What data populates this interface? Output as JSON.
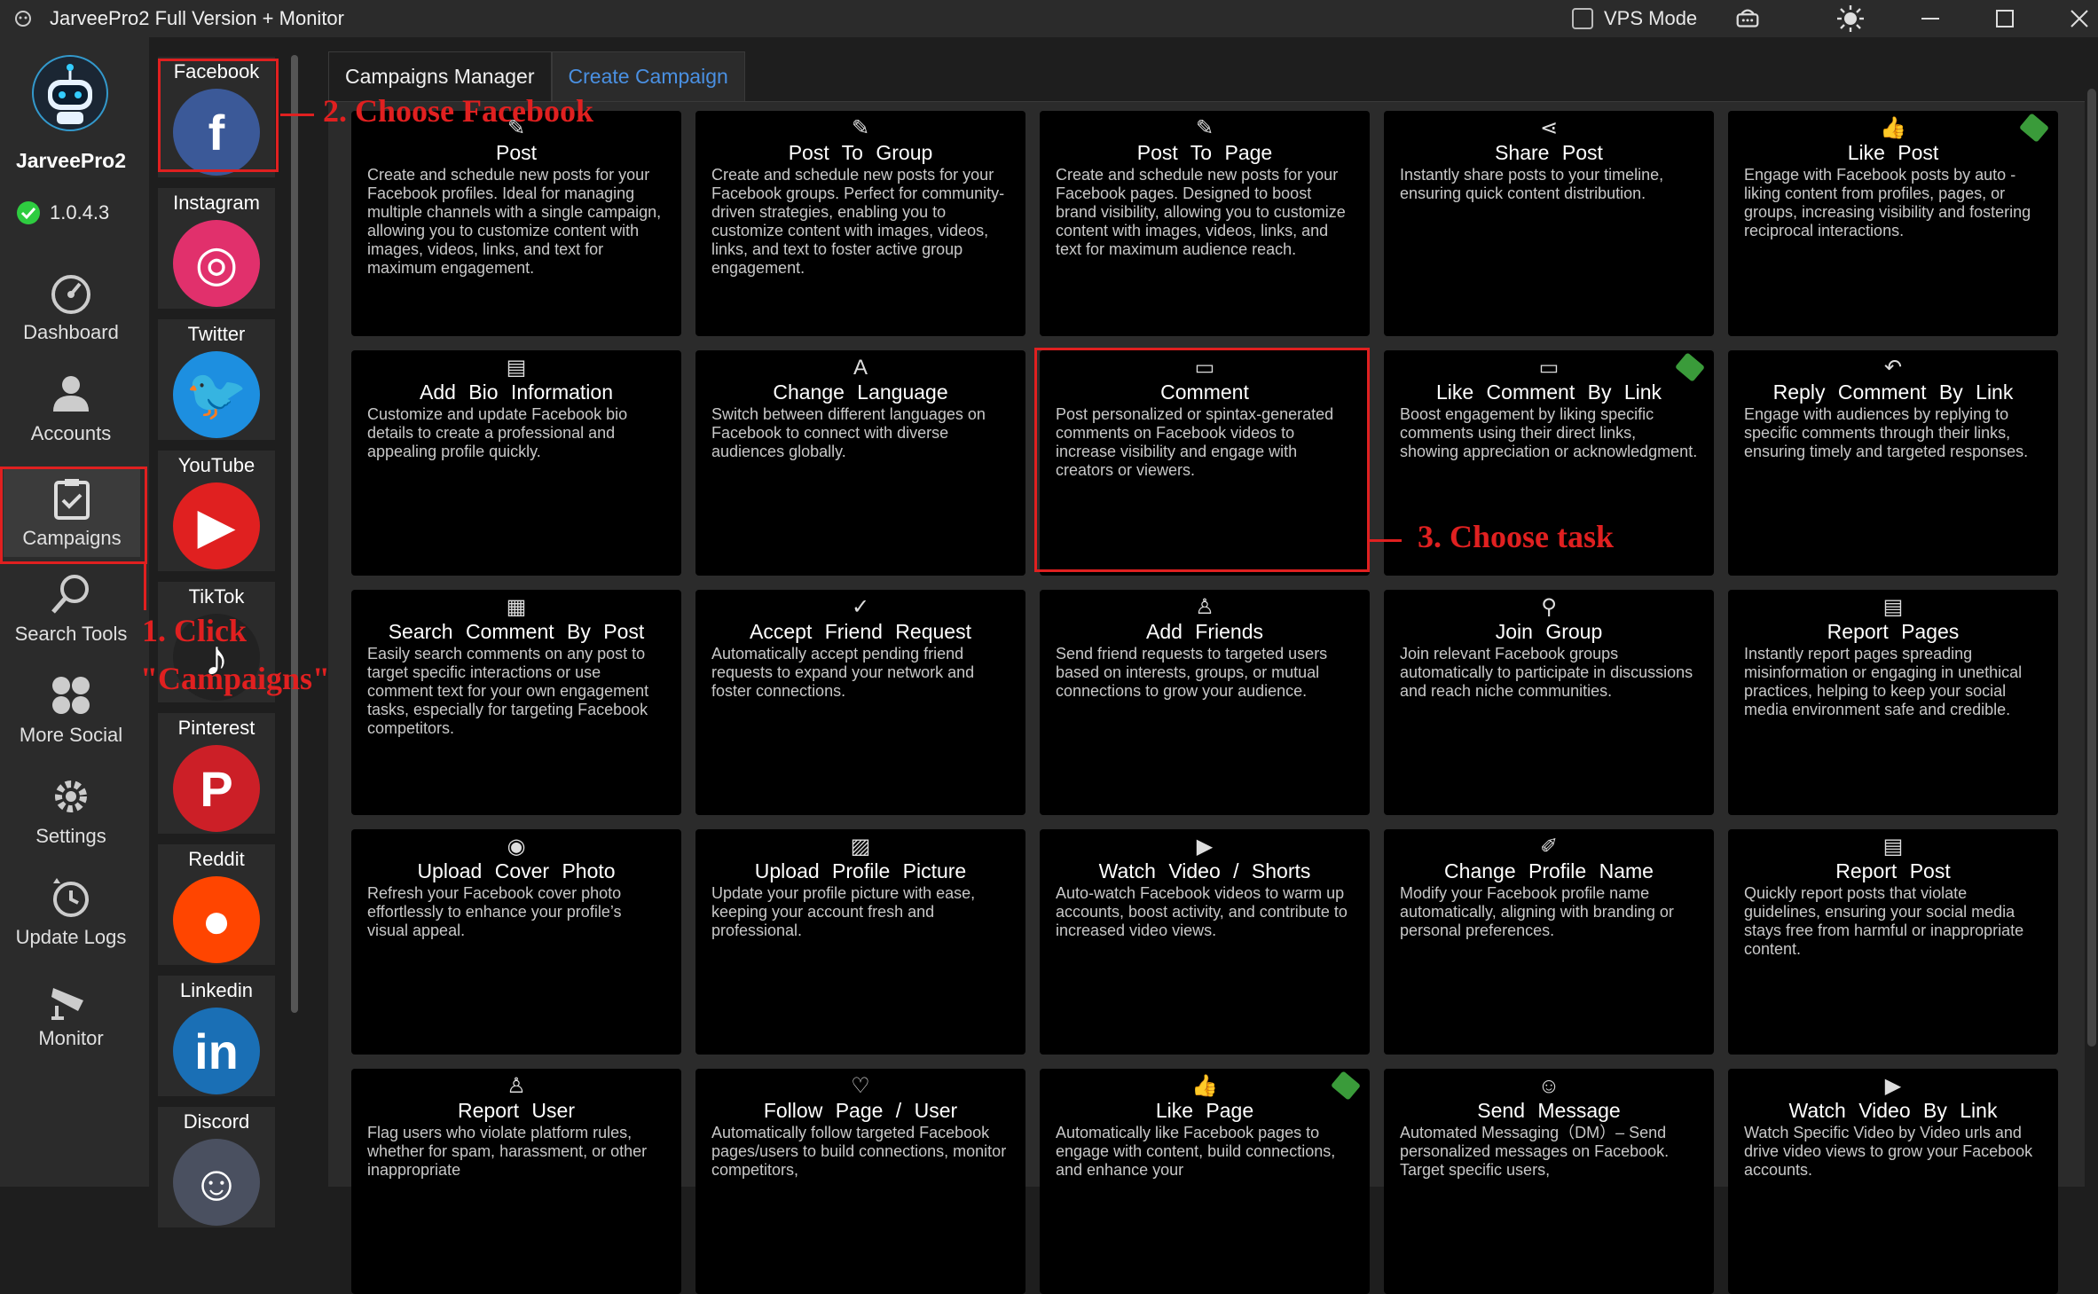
{
  "window": {
    "title": "JarveePro2 Full Version + Monitor",
    "vps_label": "VPS Mode",
    "icons": [
      "router-icon",
      "brightness-icon",
      "minimize-icon",
      "maximize-icon",
      "close-icon"
    ]
  },
  "brand": {
    "name": "JarveePro2",
    "version": "1.0.4.3"
  },
  "nav": [
    {
      "label": "Dashboard",
      "icon": "dashboard-icon"
    },
    {
      "label": "Accounts",
      "icon": "accounts-icon"
    },
    {
      "label": "Campaigns",
      "icon": "campaigns-icon",
      "active": true
    },
    {
      "label": "Search Tools",
      "icon": "search-icon"
    },
    {
      "label": "More Social",
      "icon": "more-social-icon"
    },
    {
      "label": "Settings",
      "icon": "gear-icon"
    },
    {
      "label": "Update Logs",
      "icon": "clock-icon"
    },
    {
      "label": "Monitor",
      "icon": "camera-icon"
    }
  ],
  "social": [
    {
      "name": "Facebook",
      "glyph": "f",
      "color": "#3b5998"
    },
    {
      "name": "Instagram",
      "glyph": "◎",
      "color": "#e1306c"
    },
    {
      "name": "Twitter",
      "glyph": "🐦",
      "color": "#1d8fe0"
    },
    {
      "name": "YouTube",
      "glyph": "▶",
      "color": "#e02020"
    },
    {
      "name": "TikTok",
      "glyph": "♪",
      "color": "#222222"
    },
    {
      "name": "Pinterest",
      "glyph": "P",
      "color": "#cc1f27"
    },
    {
      "name": "Reddit",
      "glyph": "●",
      "color": "#ff4500"
    },
    {
      "name": "Linkedin",
      "glyph": "in",
      "color": "#1a6fb5"
    },
    {
      "name": "Discord",
      "glyph": "☺",
      "color": "#4a5060"
    }
  ],
  "tabs": [
    "Campaigns Manager",
    "Create Campaign"
  ],
  "cards": [
    {
      "icon": "✎",
      "title": "Post",
      "desc": "Create and schedule new posts for your Facebook profiles. Ideal for managing multiple channels with a single campaign, allowing you to customize content with images, videos, links, and text for maximum engagement."
    },
    {
      "icon": "✎",
      "title": "Post To Group",
      "desc": "Create and schedule new posts for your Facebook groups. Perfect for community-driven strategies, enabling you to customize content with images, videos, links, and text to foster active group engagement."
    },
    {
      "icon": "✎",
      "title": "Post To Page",
      "desc": "Create and schedule new posts for your Facebook pages. Designed to boost brand visibility, allowing you to customize content with images, videos, links, and text for maximum audience reach."
    },
    {
      "icon": "⋖",
      "title": "Share Post",
      "desc": "Instantly share posts to your timeline, ensuring quick content distribution."
    },
    {
      "icon": "👍",
      "title": "Like Post",
      "desc": "Engage with Facebook posts by auto -liking content from profiles, pages, or groups, increasing visibility and fostering reciprocal interactions.",
      "free": true
    },
    {
      "icon": "▤",
      "title": "Add Bio Information",
      "desc": "Customize and update Facebook bio details to create a professional and appealing profile quickly."
    },
    {
      "icon": "A",
      "title": "Change Language",
      "desc": "Switch between different languages on Facebook to connect with diverse audiences globally."
    },
    {
      "icon": "▭",
      "title": "Comment",
      "desc": "Post personalized or spintax-generated comments on Facebook videos to increase visibility and engage with creators or viewers."
    },
    {
      "icon": "▭",
      "title": "Like Comment By Link",
      "desc": "Boost engagement by liking specific comments using their direct links, showing appreciation or acknowledgment.",
      "free": true
    },
    {
      "icon": "↶",
      "title": "Reply Comment By Link",
      "desc": "Engage with audiences by replying to specific comments through their links, ensuring timely and targeted responses."
    },
    {
      "icon": "▦",
      "title": "Search Comment By Post",
      "desc": "Easily search comments on any post to target specific interactions or use comment text for your own engagement tasks, especially for targeting Facebook competitors."
    },
    {
      "icon": "✓",
      "title": "Accept Friend Request",
      "desc": "Automatically accept pending friend requests to expand your network and foster connections."
    },
    {
      "icon": "♙",
      "title": "Add Friends",
      "desc": "Send friend requests to targeted users based on interests, groups, or mutual connections to grow your audience."
    },
    {
      "icon": "⚲",
      "title": "Join Group",
      "desc": "Join relevant Facebook groups automatically to participate in discussions and reach niche communities."
    },
    {
      "icon": "▤",
      "title": "Report Pages",
      "desc": "Instantly report pages spreading misinformation or engaging in unethical practices, helping to keep your social media environment safe and credible."
    },
    {
      "icon": "◉",
      "title": "Upload Cover Photo",
      "desc": "Refresh your Facebook cover photo effortlessly to enhance your profile’s visual appeal."
    },
    {
      "icon": "▨",
      "title": "Upload Profile Picture",
      "desc": "Update your profile picture with ease, keeping your account fresh and professional."
    },
    {
      "icon": "▶",
      "title": "Watch Video / Shorts",
      "desc": "Auto-watch Facebook videos to warm up accounts, boost activity, and contribute to increased video views."
    },
    {
      "icon": "✐",
      "title": "Change Profile Name",
      "desc": "Modify your Facebook profile name automatically, aligning with branding or personal preferences."
    },
    {
      "icon": "▤",
      "title": "Report Post",
      "desc": "Quickly report posts that violate guidelines, ensuring your social media stays free from harmful or inappropriate content."
    },
    {
      "icon": "♙",
      "title": "Report User",
      "desc": "Flag users who violate platform rules, whether for spam, harassment, or other inappropriate"
    },
    {
      "icon": "♡",
      "title": "Follow Page / User",
      "desc": "Automatically follow targeted Facebook pages/users to build connections, monitor competitors,"
    },
    {
      "icon": "👍",
      "title": "Like Page",
      "desc": "Automatically like Facebook pages to engage with content, build connections, and enhance your",
      "free": true
    },
    {
      "icon": "☺",
      "title": "Send Message",
      "desc": "Automated Messaging（DM）– Send personalized messages on Facebook. Target specific users,"
    },
    {
      "icon": "▶",
      "title": "Watch Video By Link",
      "desc": "Watch Specific Video by Video urls and drive video views to grow your Facebook accounts."
    }
  ],
  "annotations": {
    "step1": "1. Click",
    "step1b": "\"Campaigns\"",
    "step2": "2. Choose Facebook",
    "step3": "3. Choose task"
  },
  "colors": {
    "accent": "#4a90e2",
    "annotation": "#e02020",
    "check": "#2ecc40"
  }
}
